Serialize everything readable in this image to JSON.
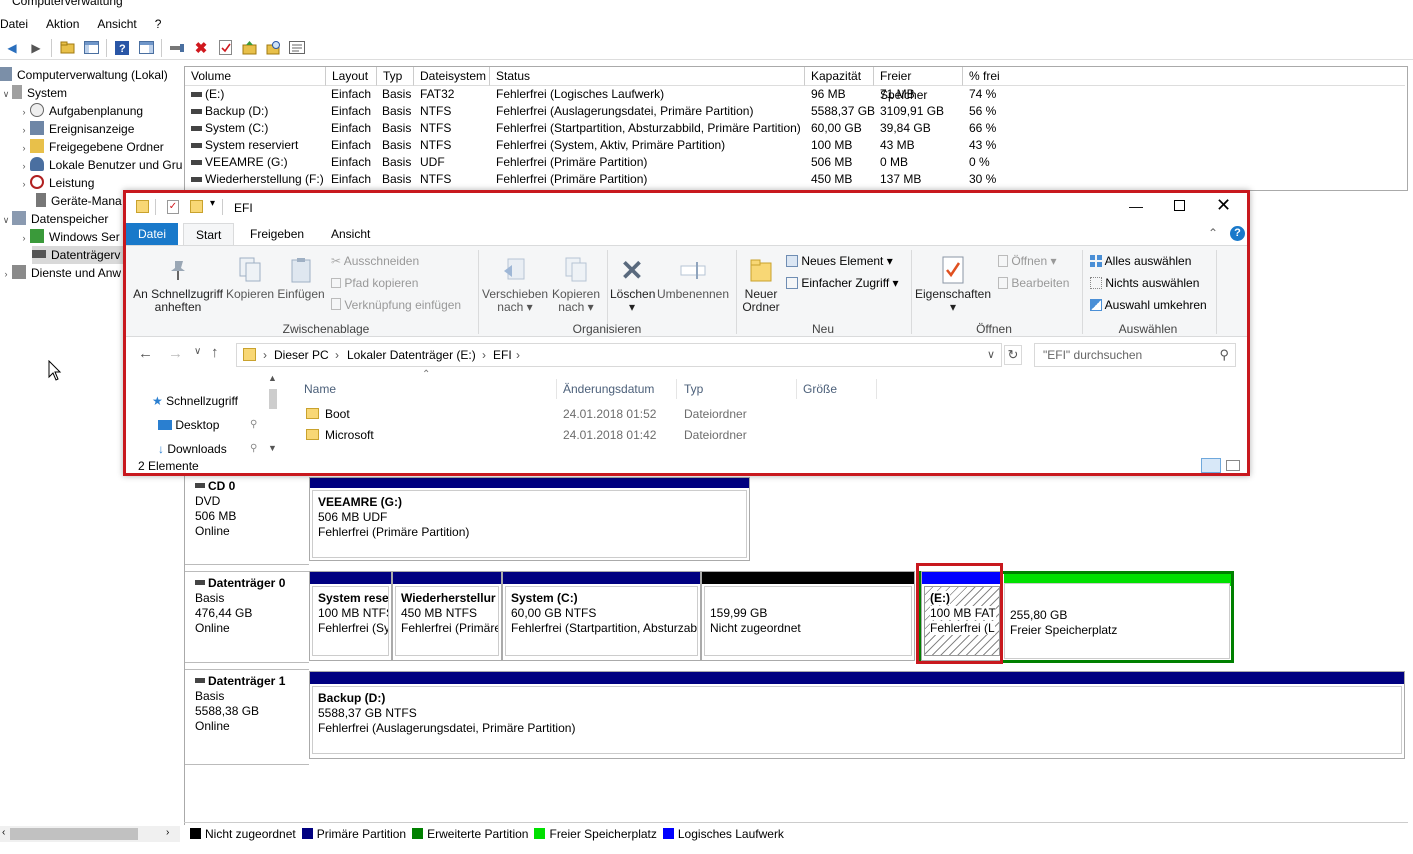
{
  "app": {
    "title": "Computerverwaltung"
  },
  "menu": [
    "Datei",
    "Aktion",
    "Ansicht",
    "?"
  ],
  "tree": {
    "root": "Computerverwaltung (Lokal)",
    "system": "System",
    "aufgaben": "Aufgabenplanung",
    "ereignis": "Ereignisanzeige",
    "freigabe": "Freigegebene Ordner",
    "benutzer": "Lokale Benutzer und Gru",
    "leistung": "Leistung",
    "geraete": "Geräte-Mana",
    "speicher": "Datenspeicher",
    "winserver": "Windows Ser",
    "datentraeger": "Datenträgerv",
    "dienste": "Dienste und Anw"
  },
  "volumes": {
    "headers": [
      "Volume",
      "Layout",
      "Typ",
      "Dateisystem",
      "Status",
      "Kapazität",
      "Freier Speicher",
      "% frei"
    ],
    "rows": [
      [
        "(E:)",
        "Einfach",
        "Basis",
        "FAT32",
        "Fehlerfrei (Logisches Laufwerk)",
        "96 MB",
        "71 MB",
        "74 %"
      ],
      [
        "Backup (D:)",
        "Einfach",
        "Basis",
        "NTFS",
        "Fehlerfrei (Auslagerungsdatei, Primäre Partition)",
        "5588,37 GB",
        "3109,91 GB",
        "56 %"
      ],
      [
        "System (C:)",
        "Einfach",
        "Basis",
        "NTFS",
        "Fehlerfrei (Startpartition, Absturzabbild, Primäre Partition)",
        "60,00 GB",
        "39,84 GB",
        "66 %"
      ],
      [
        "System reserviert",
        "Einfach",
        "Basis",
        "NTFS",
        "Fehlerfrei (System, Aktiv, Primäre Partition)",
        "100 MB",
        "43 MB",
        "43 %"
      ],
      [
        "VEEAMRE (G:)",
        "Einfach",
        "Basis",
        "UDF",
        "Fehlerfrei (Primäre Partition)",
        "506 MB",
        "0 MB",
        "0 %"
      ],
      [
        "Wiederherstellung (F:)",
        "Einfach",
        "Basis",
        "NTFS",
        "Fehlerfrei (Primäre Partition)",
        "450 MB",
        "137 MB",
        "30 %"
      ]
    ]
  },
  "disks": {
    "cd0": {
      "name": "CD 0",
      "type": "DVD",
      "size": "506 MB",
      "state": "Online",
      "part": {
        "title": "VEEAMRE  (G:)",
        "l2": "506 MB UDF",
        "l3": "Fehlerfrei (Primäre Partition)"
      }
    },
    "d0": {
      "name": "Datenträger 0",
      "type": "Basis",
      "size": "476,44 GB",
      "state": "Online",
      "parts": [
        {
          "title": "System rese",
          "l2": "100 MB NTFS",
          "l3": "Fehlerfrei (Sy"
        },
        {
          "title": "Wiederherstellur",
          "l2": "450 MB NTFS",
          "l3": "Fehlerfrei (Primäre"
        },
        {
          "title": "System  (C:)",
          "l2": "60,00 GB NTFS",
          "l3": "Fehlerfrei (Startpartition, Absturzab"
        },
        {
          "title": "",
          "l2": "159,99 GB",
          "l3": "Nicht zugeordnet"
        },
        {
          "title": "(E:)",
          "l2": "100 MB FAT",
          "l3": "Fehlerfrei (L"
        },
        {
          "title": "",
          "l2": "255,80 GB",
          "l3": "Freier Speicherplatz"
        }
      ]
    },
    "d1": {
      "name": "Datenträger 1",
      "type": "Basis",
      "size": "5588,38 GB",
      "state": "Online",
      "part": {
        "title": "Backup  (D:)",
        "l2": "5588,37 GB NTFS",
        "l3": "Fehlerfrei (Auslagerungsdatei, Primäre Partition)"
      }
    }
  },
  "legend": [
    "Nicht zugeordnet",
    "Primäre Partition",
    "Erweiterte Partition",
    "Freier Speicherplatz",
    "Logisches Laufwerk"
  ],
  "colors": {
    "unallocated": "#000000",
    "primary": "#000080",
    "extended": "#008000",
    "free": "#00e000",
    "logical": "#0000ff",
    "highlight": "#c8181e"
  },
  "explorer": {
    "title": "EFI",
    "tabs": {
      "datei": "Datei",
      "start": "Start",
      "freigeben": "Freigeben",
      "ansicht": "Ansicht"
    },
    "ribbon": {
      "pin1": "An Schnellzugriff",
      "pin2": "anheften",
      "kopieren": "Kopieren",
      "einfuegen": "Einfügen",
      "ausschneiden": "Ausschneiden",
      "pfad": "Pfad kopieren",
      "verkn": "Verknüpfung einfügen",
      "g_zwischen": "Zwischenablage",
      "verschieben1": "Verschieben",
      "verschieben2": "nach",
      "kopierennach1": "Kopieren",
      "kopierennach2": "nach",
      "loeschen": "Löschen",
      "umbenennen": "Umbenennen",
      "g_organisieren": "Organisieren",
      "neuer1": "Neuer",
      "neuer2": "Ordner",
      "neuesel": "Neues Element",
      "einfacher": "Einfacher Zugriff",
      "g_neu": "Neu",
      "eigenschaften": "Eigenschaften",
      "oeffnen": "Öffnen",
      "bearbeiten": "Bearbeiten",
      "g_oeffnen": "Öffnen",
      "alles": "Alles auswählen",
      "nichts": "Nichts auswählen",
      "umkehren": "Auswahl umkehren",
      "g_auswaehlen": "Auswählen"
    },
    "address": [
      "Dieser PC",
      "Lokaler Datenträger (E:)",
      "EFI"
    ],
    "search_placeholder": "\"EFI\" durchsuchen",
    "nav": {
      "schnell": "Schnellzugriff",
      "desktop": "Desktop",
      "downloads": "Downloads"
    },
    "columns": [
      "Name",
      "Änderungsdatum",
      "Typ",
      "Größe"
    ],
    "files": [
      {
        "name": "Boot",
        "date": "24.01.2018 01:52",
        "type": "Dateiordner"
      },
      {
        "name": "Microsoft",
        "date": "24.01.2018 01:42",
        "type": "Dateiordner"
      }
    ],
    "status": "2 Elemente"
  }
}
